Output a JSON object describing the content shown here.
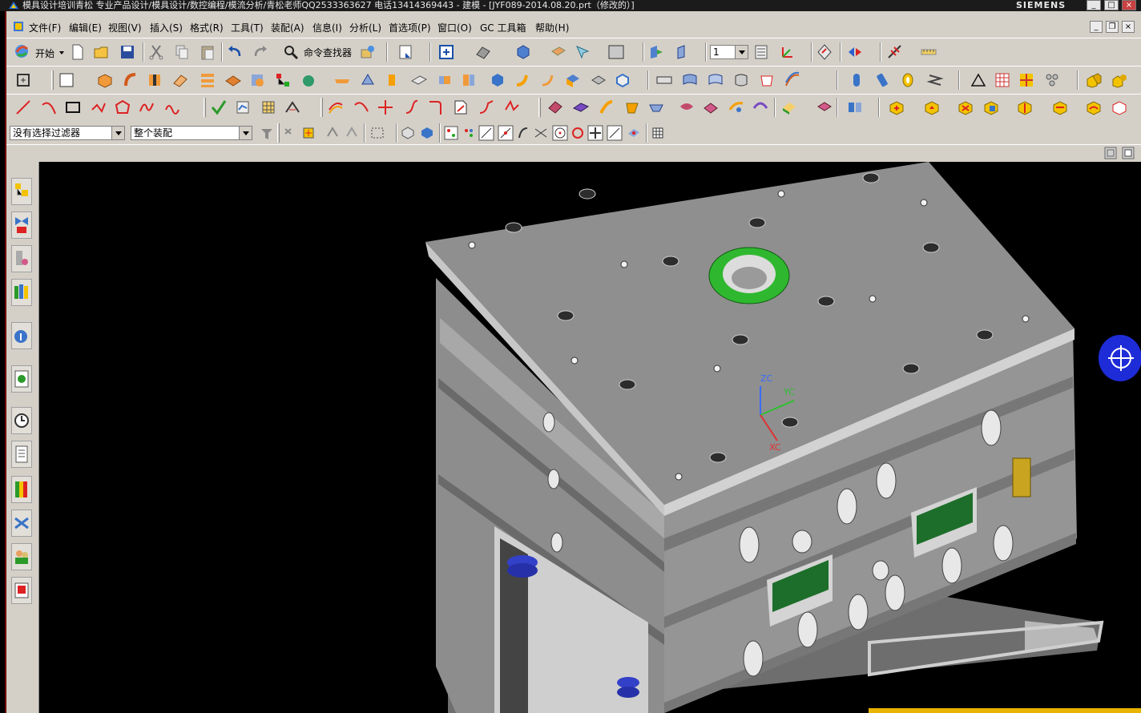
{
  "window": {
    "title": "模具设计培训青松 专业产品设计/模具设计/数控编程/模流分析/青松老师QQ2533363627 电话13414369443 - 建模 - [JYF089-2014.08.20.prt（修改的）]",
    "brand": "SIEMENS",
    "controls": {
      "minimize": "_",
      "maximize": "□",
      "close": "×"
    }
  },
  "menubar": {
    "items": [
      "文件(F)",
      "编辑(E)",
      "视图(V)",
      "插入(S)",
      "格式(R)",
      "工具(T)",
      "装配(A)",
      "信息(I)",
      "分析(L)",
      "首选项(P)",
      "窗口(O)",
      "GC 工具箱",
      "帮助(H)"
    ]
  },
  "toolbar1": {
    "start_label": "开始",
    "command_finder_label": "命令查找器",
    "layer_value": "1"
  },
  "selection": {
    "filter_value": "没有选择过滤器",
    "scope_value": "整个装配"
  },
  "viewport": {
    "csys": {
      "zc": "ZC",
      "yc": "YC",
      "xc": "XC"
    },
    "colors": {
      "background": "#000000",
      "plate": "#9a9a9a",
      "locating_ring": "#2fb82f",
      "nav_ball": "#1e2cd8"
    }
  },
  "resource_bar": {
    "icons": [
      "assembly-navigator-icon",
      "constraint-navigator-icon",
      "part-navigator-icon",
      "reuse-library-icon",
      "hd3d-tools-icon",
      "web-browser-icon",
      "history-icon",
      "system-materials-icon",
      "process-studio-icon",
      "manufacturing-wizards-icon",
      "roles-icon",
      "system-scenes-icon"
    ]
  }
}
